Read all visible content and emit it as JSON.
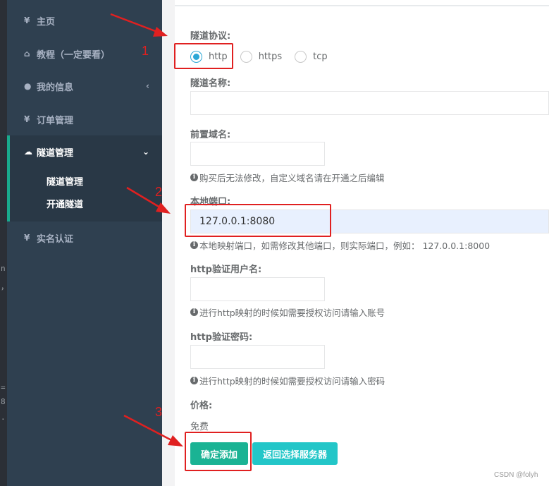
{
  "sidebar": {
    "items": [
      {
        "icon": "yen-icon",
        "glyph": "¥",
        "label": "主页"
      },
      {
        "icon": "home-icon",
        "glyph": "⌂",
        "label": "教程（一定要看）"
      },
      {
        "icon": "user-icon",
        "glyph": "●",
        "label": "我的信息"
      },
      {
        "icon": "yen-icon",
        "glyph": "¥",
        "label": "订单管理"
      },
      {
        "icon": "cloud-icon",
        "glyph": "☁",
        "label": "隧道管理"
      },
      {
        "icon": "yen-icon",
        "glyph": "¥",
        "label": "实名认证"
      }
    ],
    "submenu": [
      "隧道管理",
      "开通隧道"
    ],
    "chevron_left": "‹",
    "chevron_down": "⌄"
  },
  "form": {
    "protocol_label": "隧道协议:",
    "protocols": [
      "http",
      "https",
      "tcp"
    ],
    "selected_protocol": "http",
    "name_label": "隧道名称:",
    "name_value": "",
    "prefix_label": "前置域名:",
    "prefix_value": "",
    "prefix_help": "购买后无法修改，自定义域名请在开通之后编辑",
    "port_label": "本地端口:",
    "port_value": "127.0.0.1:8080",
    "port_help": "本地映射端口，如需修改其他端口，则实际端口，例如：  127.0.0.1:8000",
    "user_label": "http验证用户名:",
    "user_value": "",
    "user_help": "进行http映射的时候如需要授权访问请输入账号",
    "pass_label": "http验证密码:",
    "pass_value": "",
    "pass_help": "进行http映射的时候如需要授权访问请输入密码",
    "price_label": "价格:",
    "price_value": "免费",
    "submit_label": "确定添加",
    "back_label": "返回选择服务器"
  },
  "annotations": [
    "1",
    "2",
    "3"
  ],
  "colors": {
    "sidebar_bg": "#2f4050",
    "accent": "#1ab394",
    "info": "#23c6c8",
    "annotation": "#e02020"
  },
  "watermark": "CSDN @folyh",
  "editor_strip": [
    "n",
    "，",
    "=",
    "8",
    "."
  ]
}
